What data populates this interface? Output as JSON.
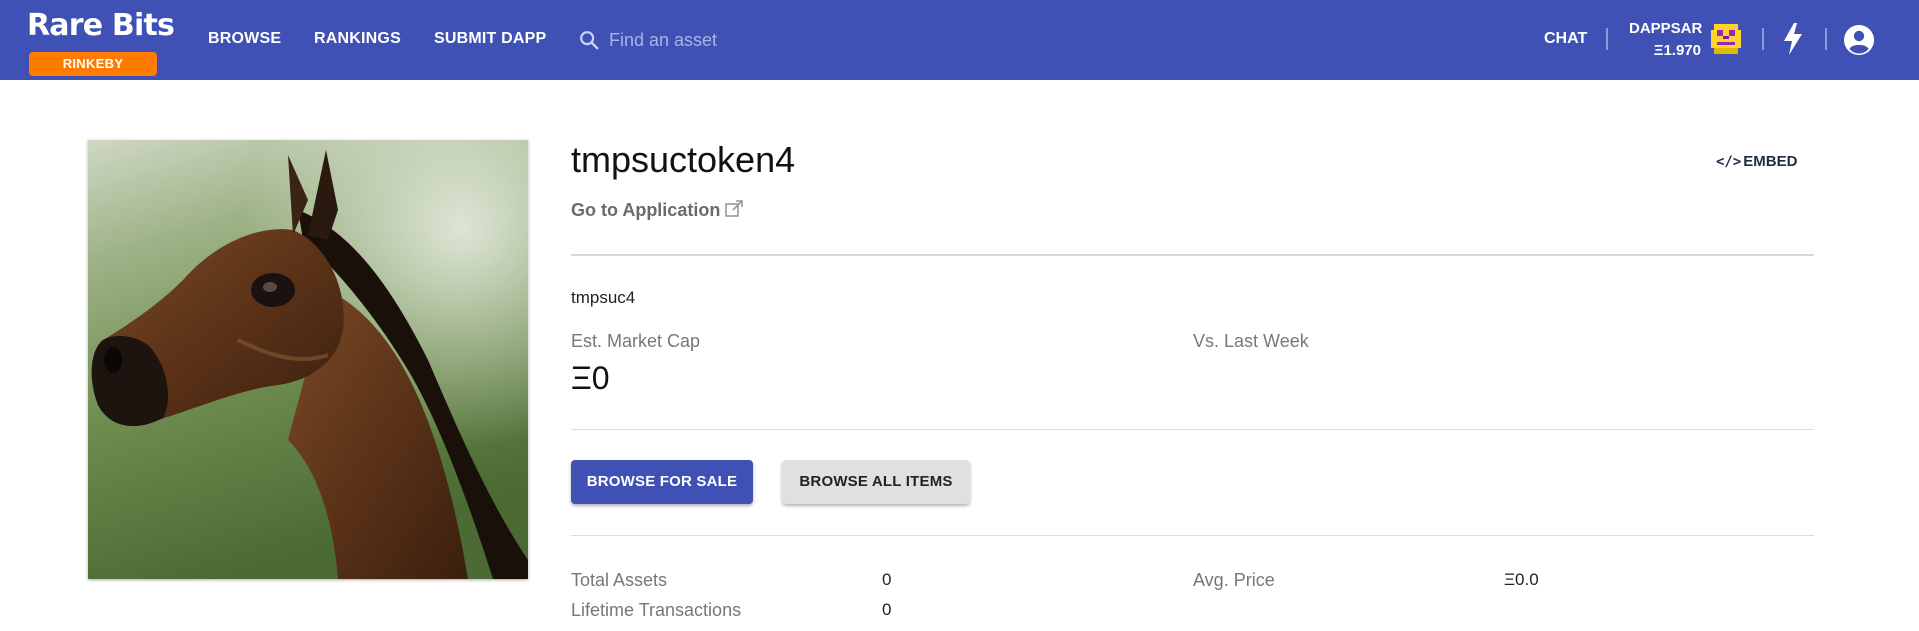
{
  "header": {
    "brand": "Rare Bits",
    "network_badge": "RINKEBY",
    "nav": [
      "BROWSE",
      "RANKINGS",
      "SUBMIT DAPP"
    ],
    "search": {
      "placeholder": "Find an asset",
      "value": "",
      "icon": "search-icon"
    },
    "chat_label": "CHAT",
    "user": {
      "name": "DAPPSAR",
      "balance": "Ξ1.970",
      "avatar_icon": "pixel-avatar-icon"
    },
    "bolt_icon": "lightning-icon",
    "account_icon": "account-circle-icon",
    "colors": {
      "bar": "#3f51b5",
      "badge": "#ff7a00"
    }
  },
  "asset": {
    "title": "tmpsuctoken4",
    "embed_label": "EMBED",
    "embed_icon": "code-icon",
    "go_to_app": "Go to Application",
    "external_icon": "external-link-icon",
    "symbol": "tmpsuc4",
    "market_cap_label": "Est. Market Cap",
    "market_cap_value": "Ξ0",
    "vs_last_week_label": "Vs. Last Week",
    "image_subject": "horse-head-photo"
  },
  "actions": {
    "browse_for_sale": "BROWSE FOR SALE",
    "browse_all": "BROWSE ALL ITEMS"
  },
  "stats": {
    "total_assets_label": "Total Assets",
    "total_assets_value": "0",
    "lifetime_tx_label": "Lifetime Transactions",
    "lifetime_tx_value": "0",
    "avg_price_label": "Avg. Price",
    "avg_price_value": "Ξ0.0"
  }
}
